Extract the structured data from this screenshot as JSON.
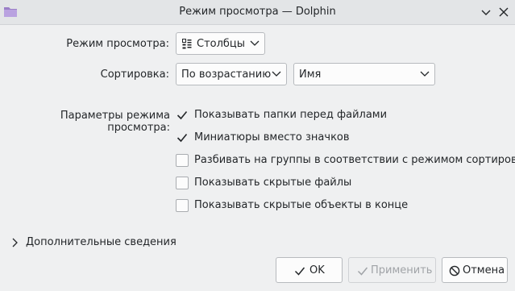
{
  "window": {
    "title": "Режим просмотра — Dolphin",
    "app_icon": "folder-icon",
    "controls": {
      "minimize_icon": "chevron-down-icon",
      "close_icon": "close-icon"
    }
  },
  "view_mode": {
    "label": "Режим просмотра:",
    "selected": "Столбцы",
    "icon": "columns-view-icon"
  },
  "sorting": {
    "label": "Сортировка:",
    "order_selected": "По возрастанию",
    "field_selected": "Имя"
  },
  "view_options": {
    "label": "Параметры режима просмотра:",
    "items": [
      {
        "label": "Показывать папки перед файлами",
        "checked": true
      },
      {
        "label": "Миниатюры вместо значков",
        "checked": true
      },
      {
        "label": "Разбивать на группы в соответствии с режимом сортировки",
        "checked": false
      },
      {
        "label": "Показывать скрытые файлы",
        "checked": false
      },
      {
        "label": "Показывать скрытые объекты в конце",
        "checked": false
      }
    ]
  },
  "details": {
    "label": "Дополнительные сведения",
    "expanded": false
  },
  "buttons": {
    "ok": "OK",
    "apply": "Применить",
    "cancel": "Отмена"
  },
  "colors": {
    "accent": "#3daee9",
    "background": "#eff0f1",
    "text": "#232629"
  }
}
